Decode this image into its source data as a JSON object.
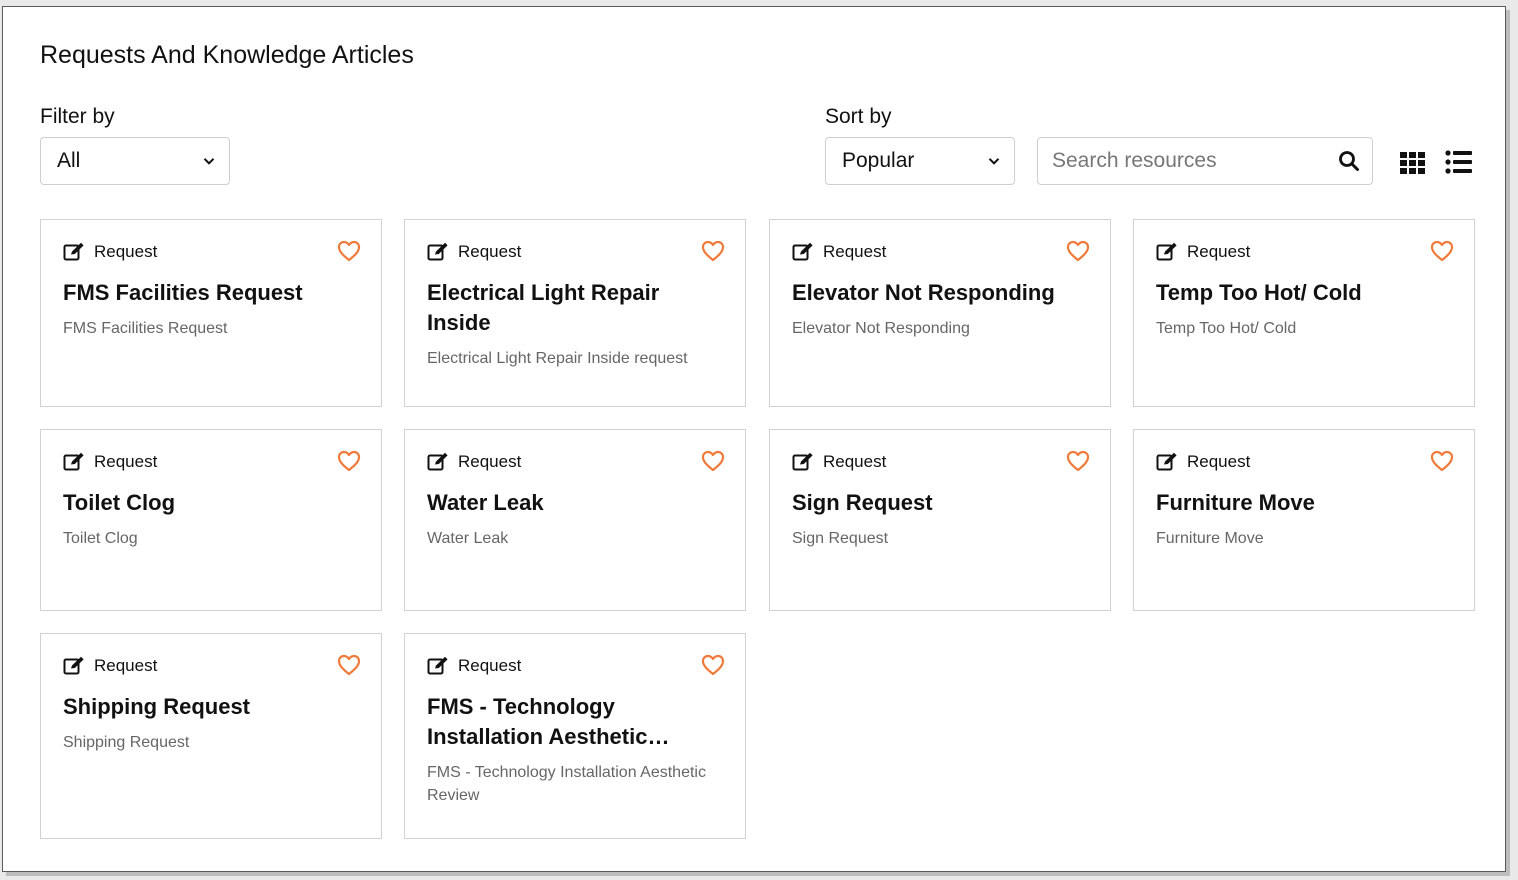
{
  "header": {
    "title": "Requests And Knowledge Articles"
  },
  "filter": {
    "label": "Filter by",
    "selected": "All"
  },
  "sort": {
    "label": "Sort by",
    "selected": "Popular"
  },
  "search": {
    "placeholder": "Search resources"
  },
  "view_toggle": {
    "grid_icon": "grid-view-icon",
    "list_icon": "list-view-icon"
  },
  "colors": {
    "heart": "#f07a3a",
    "border": "#d2d2d2",
    "description": "#666666"
  },
  "cards": [
    {
      "type": "Request",
      "title": "FMS Facilities Request",
      "description": "FMS Facilities Request"
    },
    {
      "type": "Request",
      "title": "Electrical Light Repair Inside",
      "description": "Electrical Light Repair Inside request"
    },
    {
      "type": "Request",
      "title": "Elevator Not Responding",
      "description": "Elevator Not Responding"
    },
    {
      "type": "Request",
      "title": "Temp Too Hot/ Cold",
      "description": "Temp Too Hot/ Cold"
    },
    {
      "type": "Request",
      "title": "Toilet Clog",
      "description": "Toilet Clog"
    },
    {
      "type": "Request",
      "title": "Water Leak",
      "description": "Water Leak"
    },
    {
      "type": "Request",
      "title": "Sign Request",
      "description": "Sign Request"
    },
    {
      "type": "Request",
      "title": "Furniture Move",
      "description": "Furniture Move"
    },
    {
      "type": "Request",
      "title": "Shipping Request",
      "description": "Shipping Request"
    },
    {
      "type": "Request",
      "title": "FMS - Technology Installation Aesthetic…",
      "description": "FMS - Technology Installation Aesthetic Review"
    }
  ]
}
